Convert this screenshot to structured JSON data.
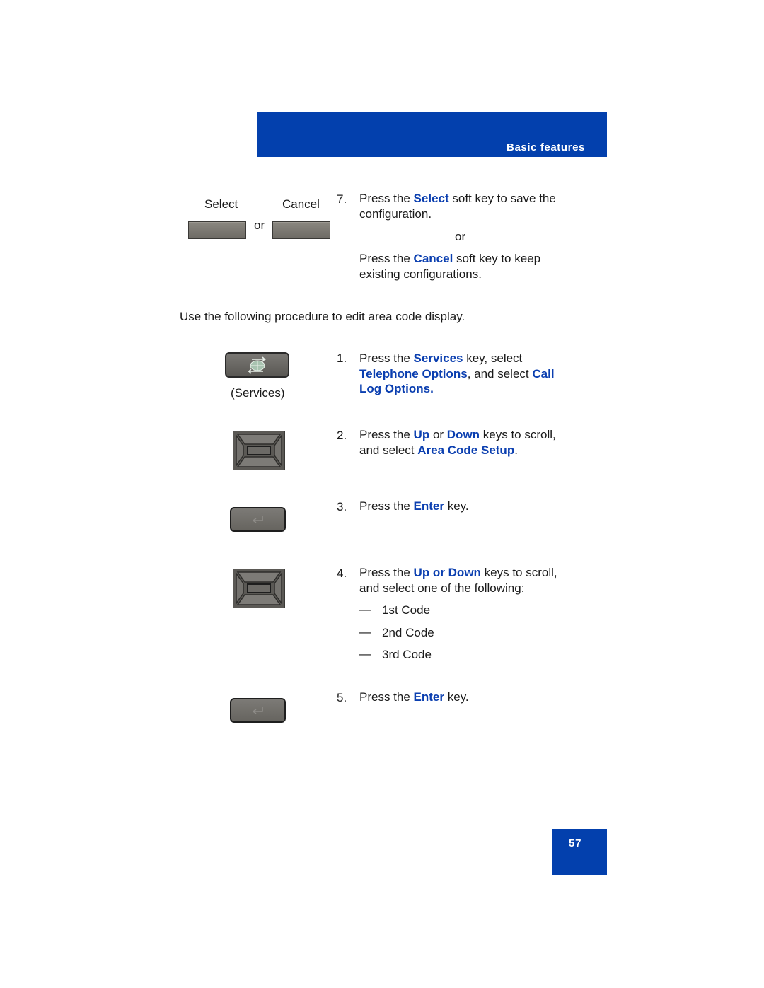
{
  "header": {
    "section_title": "Basic features"
  },
  "footer": {
    "page_number": "57"
  },
  "softkeys": {
    "select_label": "Select",
    "cancel_label": "Cancel",
    "or_label": "or"
  },
  "step7": {
    "number": "7.",
    "line1_pre": "Press the ",
    "line1_hl": "Select",
    "line1_post": " soft key to save the",
    "line2": "configuration.",
    "or_label": "or",
    "line3_pre": "Press the ",
    "line3_hl": "Cancel",
    "line3_post": " soft key to keep",
    "line4": "existing configurations."
  },
  "intro": "Use the following procedure to edit area code display.",
  "services_key": {
    "caption": "(Services)",
    "icon": "services-globe-arrows-icon"
  },
  "steps": [
    {
      "number": "1.",
      "pre": "Press the ",
      "hl1": "Services",
      "mid1": " key, select",
      "hl2": "Telephone Options",
      "mid2": ", and select ",
      "hl3": "Call",
      "hl4": "Log Options."
    },
    {
      "number": "2.",
      "pre": "Press the ",
      "hl1": "Up",
      "mid1": " or ",
      "hl2": "Down",
      "mid2": " keys to scroll,",
      "line2_pre": "and select ",
      "hl3": "Area Code Setup",
      "end": "."
    },
    {
      "number": "3.",
      "pre": "Press the ",
      "hl1": "Enter",
      "post": " key."
    },
    {
      "number": "4.",
      "pre": "Press the ",
      "hl1": "Up or Down",
      "post": " keys to scroll,",
      "line2": "and select one of the following:",
      "options": [
        "1st Code",
        "2nd Code",
        "3rd Code"
      ],
      "dash": "—"
    },
    {
      "number": "5.",
      "pre": "Press the ",
      "hl1": "Enter",
      "post": " key."
    }
  ],
  "colors": {
    "brand_blue": "#0340ad",
    "highlight_blue": "#0b3fb0"
  }
}
